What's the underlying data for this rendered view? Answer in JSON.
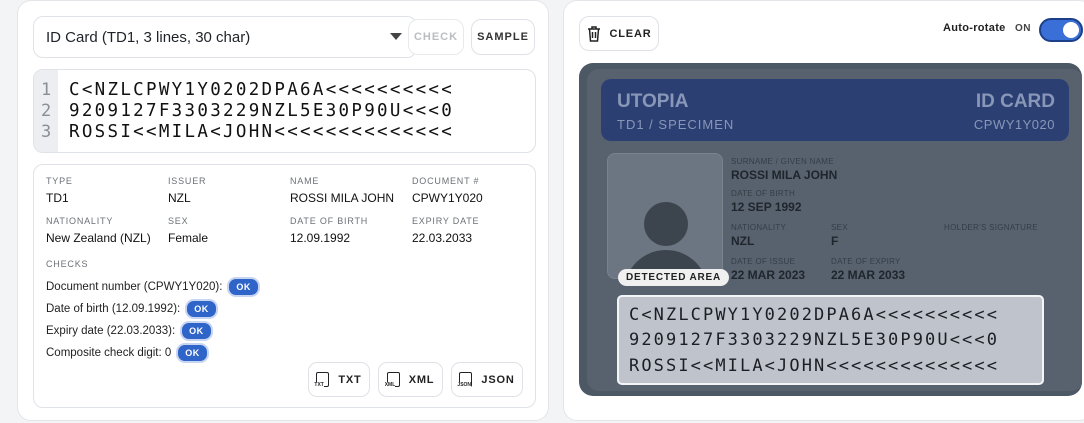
{
  "doc_select": {
    "value": "ID Card (TD1, 3 lines, 30 char)"
  },
  "actions": {
    "check": "CHECK",
    "sample": "SAMPLE"
  },
  "mrz": {
    "line_numbers": [
      "1",
      "2",
      "3"
    ],
    "lines": [
      "C<NZLCPWY1Y0202DPA6A<<<<<<<<<<",
      "9209127F3303229NZL5E30P90U<<<0",
      "ROSSI<<MILA<JOHN<<<<<<<<<<<<<<"
    ]
  },
  "fields": {
    "type": {
      "label": "TYPE",
      "value": "TD1"
    },
    "issuer": {
      "label": "ISSUER",
      "value": "NZL"
    },
    "name": {
      "label": "NAME",
      "value": "ROSSI MILA JOHN"
    },
    "document": {
      "label": "DOCUMENT #",
      "value": "CPWY1Y020"
    },
    "nationality": {
      "label": "NATIONALITY",
      "value": "New Zealand (NZL)"
    },
    "sex": {
      "label": "SEX",
      "value": "Female"
    },
    "dob": {
      "label": "DATE OF BIRTH",
      "value": "12.09.1992"
    },
    "expiry": {
      "label": "EXPIRY DATE",
      "value": "22.03.2033"
    }
  },
  "checks": {
    "title": "CHECKS",
    "items": [
      {
        "label": "Document number (CPWY1Y020):",
        "status": "OK"
      },
      {
        "label": "Date of birth (12.09.1992):",
        "status": "OK"
      },
      {
        "label": "Expiry date (22.03.2033):",
        "status": "OK"
      },
      {
        "label": "Composite check digit: 0",
        "status": "OK"
      }
    ]
  },
  "export": {
    "txt": {
      "label": "TXT",
      "icon_text": "TXT"
    },
    "xml": {
      "label": "XML",
      "icon_text": "XML"
    },
    "json": {
      "label": "JSON",
      "icon_text": "JSON"
    }
  },
  "right": {
    "clear": "CLEAR",
    "auto_rotate": "Auto-rotate",
    "toggle_state": "ON",
    "toggle_on": true
  },
  "card": {
    "country": "UTOPIA",
    "subtitle": "TD1 / SPECIMEN",
    "doc_type": "ID CARD",
    "doc_number": "CPWY1Y020",
    "surname_label": "SURNAME / GIVEN NAME",
    "surname_value": "ROSSI MILA JOHN",
    "dob_label": "DATE OF BIRTH",
    "dob_value": "12 SEP 1992",
    "nationality_label": "NATIONALITY",
    "nationality_value": "NZL",
    "sex_label": "SEX",
    "sex_value": "F",
    "signature_label": "HOLDER'S SIGNATURE",
    "issue_label": "DATE OF ISSUE",
    "issue_value": "22 MAR 2023",
    "expiry_label": "DATE OF EXPIRY",
    "expiry_value": "22 MAR 2033",
    "detected_label": "DETECTED AREA",
    "mrz_lines": [
      "C<NZLCPWY1Y0202DPA6A<<<<<<<<<<",
      "9209127F3303229NZL5E30P90U<<<0",
      "ROSSI<<MILA<JOHN<<<<<<<<<<<<<<"
    ]
  },
  "colors": {
    "accent": "#2f64c8",
    "card_header": "#2c3f73"
  }
}
